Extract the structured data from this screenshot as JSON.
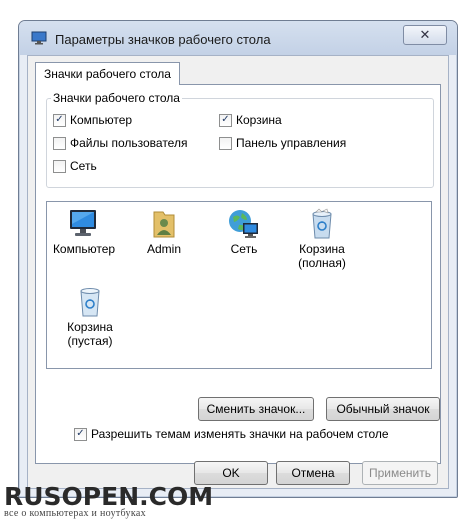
{
  "window": {
    "title": "Параметры значков рабочего стола",
    "close_symbol": "✕"
  },
  "tab": {
    "label": "Значки рабочего стола"
  },
  "group": {
    "legend": "Значки рабочего стола",
    "checkboxes": [
      {
        "label": "Компьютер",
        "checked": true
      },
      {
        "label": "Корзина",
        "checked": true
      },
      {
        "label": "Файлы пользователя",
        "checked": false
      },
      {
        "label": "Панель управления",
        "checked": false
      },
      {
        "label": "Сеть",
        "checked": false
      }
    ],
    "check_glyph": "✓"
  },
  "icons": [
    {
      "icon": "computer-icon",
      "label": "Компьютер"
    },
    {
      "icon": "user-folder-icon",
      "label": "Admin"
    },
    {
      "icon": "network-icon",
      "label": "Сеть"
    },
    {
      "icon": "recycle-bin-full-icon",
      "label": "Корзина\n(полная)"
    },
    {
      "icon": "recycle-bin-empty-icon",
      "label": "Корзина\n(пустая)"
    }
  ],
  "buttons": {
    "change_icon": "Сменить значок...",
    "default_icon": "Обычный значок",
    "ok": "OK",
    "cancel": "Отмена",
    "apply": "Применить"
  },
  "allow_themes": {
    "label": "Разрешить темам изменять значки на рабочем столе",
    "checked": true
  },
  "watermark": {
    "main": "RUSOPEN.COM",
    "sub": "все о компьютерах и ноутбуках"
  }
}
